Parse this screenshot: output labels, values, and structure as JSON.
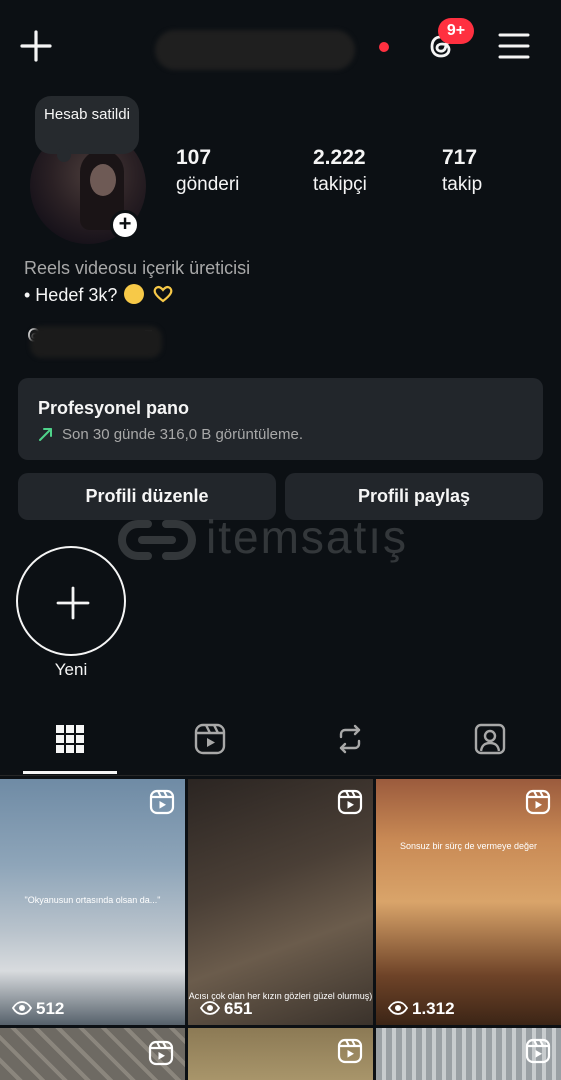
{
  "topbar": {
    "username": "n",
    "badge": "9+"
  },
  "profile": {
    "note": "Hesab satildi",
    "stats": [
      {
        "value": "107",
        "label": "gönderi"
      },
      {
        "value": "2.222",
        "label": "takipçi"
      },
      {
        "value": "717",
        "label": "takip"
      }
    ],
    "category": "Reels videosu içerik üreticisi",
    "bio": "• Hedef 3k?",
    "threads_handle": "z"
  },
  "dashboard": {
    "title": "Profesyonel pano",
    "subtitle": "Son 30 günde 316,0 B görüntüleme."
  },
  "buttons": {
    "edit": "Profili düzenle",
    "share": "Profili paylaş"
  },
  "watermark": {
    "text": "itemsatış"
  },
  "highlights": {
    "new_label": "Yeni"
  },
  "tabs": [
    "grid-icon",
    "reels-icon",
    "reposts-icon",
    "tagged-icon"
  ],
  "grid": [
    {
      "views": "512",
      "caption": "\"Okyanusun ortasında olsan da...\""
    },
    {
      "views": "651",
      "caption": "Acısı çok olan her kızın gözleri güzel olurmuş)"
    },
    {
      "views": "1.312",
      "caption": "Sonsuz bir sürç de vermeye değer"
    }
  ],
  "colors": {
    "background": "#0c1014",
    "panel": "#22262b",
    "badge": "#ff3040",
    "trend": "#4fd28a",
    "secondary_text": "#a8a8a8"
  }
}
